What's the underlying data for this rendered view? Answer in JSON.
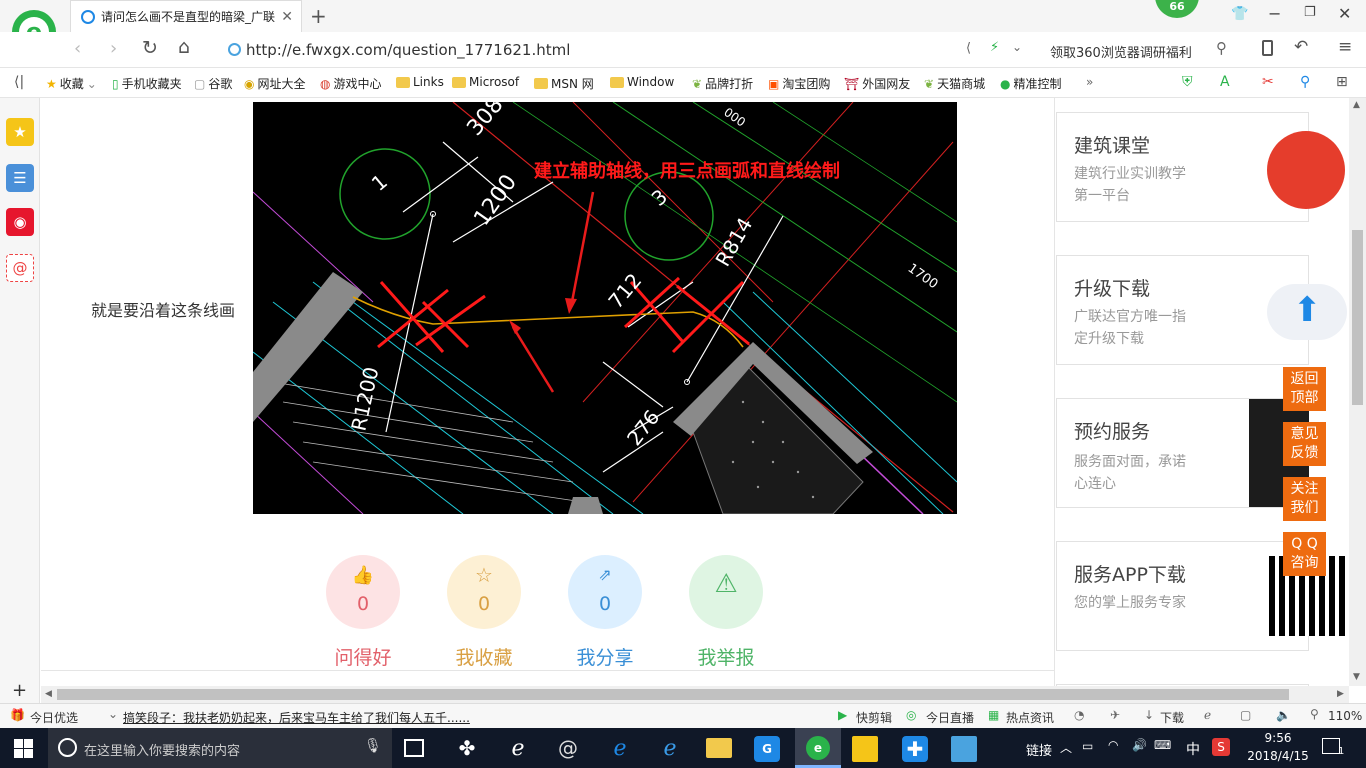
{
  "browser": {
    "tab_title": "请问怎么画不是直型的暗梁_广联",
    "badge": "66",
    "url": "http://e.fwxgx.com/question_1771621.html",
    "promo": "领取360浏览器调研福利",
    "bookmarks": [
      "收藏",
      "手机收藏夹",
      "谷歌",
      "网址大全",
      "游戏中心",
      "Links",
      "Microsof",
      "MSN 网",
      "Window",
      "品牌打折",
      "淘宝团购",
      "外国网友",
      "天猫商城",
      "精准控制"
    ]
  },
  "question": {
    "caption": "就是要沿着这条线画",
    "annotation": "建立辅助轴线，用三点画弧和直线绘制",
    "dims": {
      "d308": "308",
      "d1200": "1200",
      "d712": "712",
      "r814": "R814",
      "r1200": "R1200",
      "d276": "276",
      "d1700": "1700",
      "c1": "1",
      "c3": "3",
      "d000": "000"
    }
  },
  "actions": [
    {
      "label": "问得好",
      "count": "0",
      "color": "#e2606a",
      "bg": "#fde3e4"
    },
    {
      "label": "我收藏",
      "count": "0",
      "color": "#d9a043",
      "bg": "#fdf0d4"
    },
    {
      "label": "我分享",
      "count": "0",
      "color": "#3a8fd6",
      "bg": "#dcefff"
    },
    {
      "label": "我举报",
      "count": "0",
      "color": "#4fb468",
      "bg": "#dff5e3"
    }
  ],
  "sidebar_cards": [
    {
      "title": "建筑课堂",
      "sub": "建筑行业实训教学第一平台"
    },
    {
      "title": "升级下载",
      "sub": "广联达官方唯一指定升级下载"
    },
    {
      "title": "预约服务",
      "sub": "服务面对面，承诺心连心"
    },
    {
      "title": "服务APP下载",
      "sub": "您的掌上服务专家"
    }
  ],
  "float_buttons": [
    {
      "line1": "返回",
      "line2": "顶部"
    },
    {
      "line1": "意见",
      "line2": "反馈"
    },
    {
      "line1": "关注",
      "line2": "我们"
    },
    {
      "line1": "Q Q",
      "line2": "咨询"
    }
  ],
  "status": {
    "today": "今日优选",
    "news": "搞笑段子：我扶老奶奶起来，后来宝马车主给了我们每人五千......",
    "items": [
      "快剪辑",
      "今日直播",
      "热点资讯"
    ],
    "download": "下载",
    "zoom": "110%"
  },
  "taskbar": {
    "search_placeholder": "在这里输入你要搜索的内容",
    "link": "链接",
    "ime": "中",
    "time": "9:56",
    "date": "2018/4/15",
    "notif": "1"
  }
}
